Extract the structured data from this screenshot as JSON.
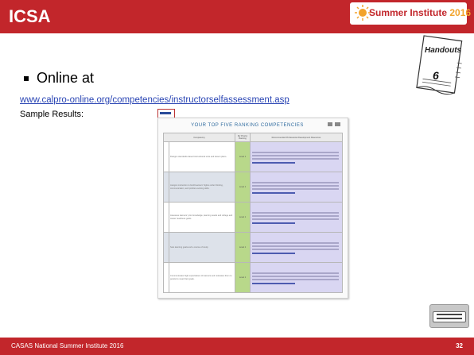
{
  "slide": {
    "title": "ICSA",
    "logo_text_main": "Summer Institute",
    "logo_text_year": "2016",
    "handout_label": "Handouts",
    "handout_number": "6",
    "bullet_text": "Online at",
    "url_text": "www.calpro-online.org/competencies/instructorselfassessment.asp",
    "sample_label": "Sample Results:",
    "footer_text": "CASAS National Summer Institute 2016",
    "page_number": "32"
  },
  "document": {
    "title": "YOUR TOP FIVE RANKING COMPETENCIES",
    "headers": [
      "Competency",
      "My Priority Ranking",
      "Recommended Professional Development Resources"
    ],
    "rows": [
      {
        "num": "",
        "competency": "Designs standards-based instructional units and lesson plans.",
        "rank": "Level 1"
      },
      {
        "num": "",
        "competency": "Assigns instruction to build learners' higher-order thinking, communication, and problem-solving skills.",
        "rank": "Level 1"
      },
      {
        "num": "",
        "competency": "Assesses learners' prior knowledge, learning needs and college and career readiness goals.",
        "rank": "Level 1"
      },
      {
        "num": "",
        "competency": "Sets learning goals and a course of study.",
        "rank": "Level 1"
      },
      {
        "num": "",
        "competency": "Communicates high expectations of learners and motivates them to persist to meet their goals.",
        "rank": "Level 1"
      }
    ]
  },
  "colors": {
    "brand_red": "#c2262b",
    "link_blue": "#2a45b4",
    "logo_accent": "#f2a32a"
  }
}
